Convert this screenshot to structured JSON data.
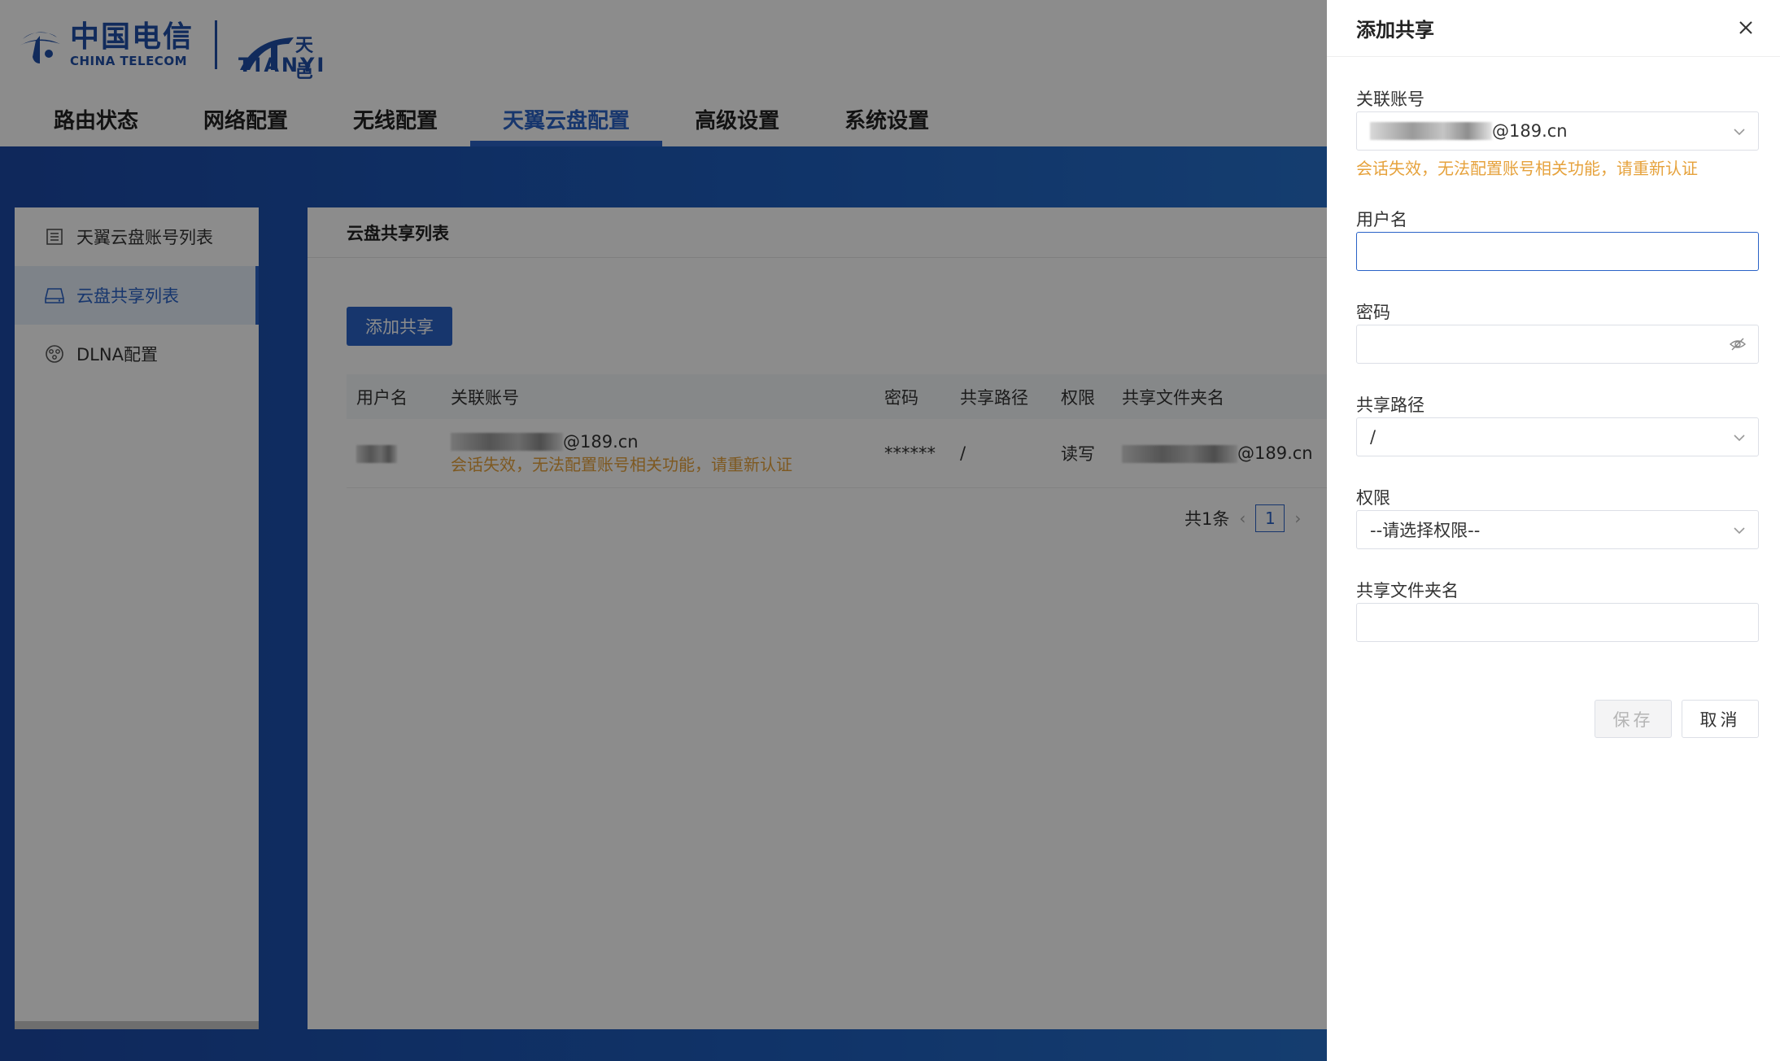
{
  "header": {
    "brand_cn": "中国电信",
    "brand_en": "CHINA TELECOM",
    "tianyi_cn": "天邑",
    "tianyi_en": "TIANYI"
  },
  "nav": {
    "items": [
      {
        "label": "路由状态"
      },
      {
        "label": "网络配置"
      },
      {
        "label": "无线配置"
      },
      {
        "label": "天翼云盘配置",
        "active": true
      },
      {
        "label": "高级设置"
      },
      {
        "label": "系统设置"
      }
    ]
  },
  "sidebar": {
    "items": [
      {
        "label": "天翼云盘账号列表",
        "icon": "list-icon"
      },
      {
        "label": "云盘共享列表",
        "icon": "drive-icon",
        "active": true
      },
      {
        "label": "DLNA配置",
        "icon": "dlna-icon"
      }
    ]
  },
  "panel": {
    "title": "云盘共享列表",
    "add_button": "添加共享",
    "columns": [
      "用户名",
      "关联账号",
      "密码",
      "共享路径",
      "权限",
      "共享文件夹名"
    ],
    "rows": [
      {
        "username": "",
        "account_suffix": "@189.cn",
        "account_warning": "会话失效，无法配置账号相关功能，请重新认证",
        "password": "******",
        "path": "/",
        "permission": "读写",
        "folder_suffix": "@189.cn"
      }
    ],
    "pager": {
      "total": "共1条",
      "prev": "‹",
      "page": "1",
      "next": "›"
    }
  },
  "drawer": {
    "title": "添加共享",
    "account": {
      "label": "关联账号",
      "value_suffix": "@189.cn",
      "warning": "会话失效，无法配置账号相关功能，请重新认证"
    },
    "username": {
      "label": "用户名",
      "value": ""
    },
    "password": {
      "label": "密码",
      "value": ""
    },
    "share_path": {
      "label": "共享路径",
      "value": "/"
    },
    "permission": {
      "label": "权限",
      "value": "--请选择权限--"
    },
    "folder_name": {
      "label": "共享文件夹名",
      "value": ""
    },
    "save_label": "保存",
    "cancel_label": "取消"
  },
  "colors": {
    "accent": "#2a63c7",
    "warning": "#e6a23c",
    "overlay": "rgba(0,0,0,0.45)"
  }
}
